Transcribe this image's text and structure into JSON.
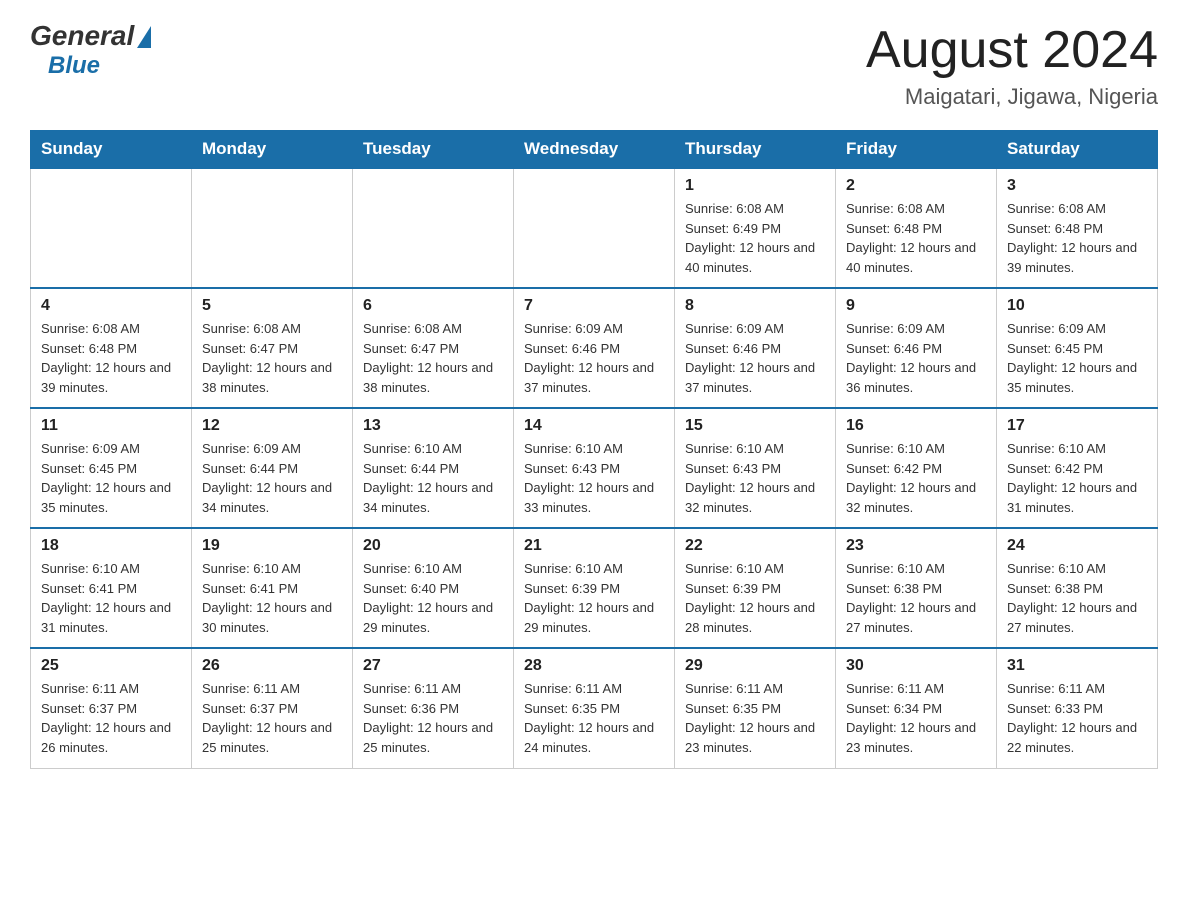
{
  "header": {
    "logo_general": "General",
    "logo_blue": "Blue",
    "month_title": "August 2024",
    "location": "Maigatari, Jigawa, Nigeria"
  },
  "days_of_week": [
    "Sunday",
    "Monday",
    "Tuesday",
    "Wednesday",
    "Thursday",
    "Friday",
    "Saturday"
  ],
  "weeks": [
    [
      {
        "day": "",
        "info": ""
      },
      {
        "day": "",
        "info": ""
      },
      {
        "day": "",
        "info": ""
      },
      {
        "day": "",
        "info": ""
      },
      {
        "day": "1",
        "info": "Sunrise: 6:08 AM\nSunset: 6:49 PM\nDaylight: 12 hours and 40 minutes."
      },
      {
        "day": "2",
        "info": "Sunrise: 6:08 AM\nSunset: 6:48 PM\nDaylight: 12 hours and 40 minutes."
      },
      {
        "day": "3",
        "info": "Sunrise: 6:08 AM\nSunset: 6:48 PM\nDaylight: 12 hours and 39 minutes."
      }
    ],
    [
      {
        "day": "4",
        "info": "Sunrise: 6:08 AM\nSunset: 6:48 PM\nDaylight: 12 hours and 39 minutes."
      },
      {
        "day": "5",
        "info": "Sunrise: 6:08 AM\nSunset: 6:47 PM\nDaylight: 12 hours and 38 minutes."
      },
      {
        "day": "6",
        "info": "Sunrise: 6:08 AM\nSunset: 6:47 PM\nDaylight: 12 hours and 38 minutes."
      },
      {
        "day": "7",
        "info": "Sunrise: 6:09 AM\nSunset: 6:46 PM\nDaylight: 12 hours and 37 minutes."
      },
      {
        "day": "8",
        "info": "Sunrise: 6:09 AM\nSunset: 6:46 PM\nDaylight: 12 hours and 37 minutes."
      },
      {
        "day": "9",
        "info": "Sunrise: 6:09 AM\nSunset: 6:46 PM\nDaylight: 12 hours and 36 minutes."
      },
      {
        "day": "10",
        "info": "Sunrise: 6:09 AM\nSunset: 6:45 PM\nDaylight: 12 hours and 35 minutes."
      }
    ],
    [
      {
        "day": "11",
        "info": "Sunrise: 6:09 AM\nSunset: 6:45 PM\nDaylight: 12 hours and 35 minutes."
      },
      {
        "day": "12",
        "info": "Sunrise: 6:09 AM\nSunset: 6:44 PM\nDaylight: 12 hours and 34 minutes."
      },
      {
        "day": "13",
        "info": "Sunrise: 6:10 AM\nSunset: 6:44 PM\nDaylight: 12 hours and 34 minutes."
      },
      {
        "day": "14",
        "info": "Sunrise: 6:10 AM\nSunset: 6:43 PM\nDaylight: 12 hours and 33 minutes."
      },
      {
        "day": "15",
        "info": "Sunrise: 6:10 AM\nSunset: 6:43 PM\nDaylight: 12 hours and 32 minutes."
      },
      {
        "day": "16",
        "info": "Sunrise: 6:10 AM\nSunset: 6:42 PM\nDaylight: 12 hours and 32 minutes."
      },
      {
        "day": "17",
        "info": "Sunrise: 6:10 AM\nSunset: 6:42 PM\nDaylight: 12 hours and 31 minutes."
      }
    ],
    [
      {
        "day": "18",
        "info": "Sunrise: 6:10 AM\nSunset: 6:41 PM\nDaylight: 12 hours and 31 minutes."
      },
      {
        "day": "19",
        "info": "Sunrise: 6:10 AM\nSunset: 6:41 PM\nDaylight: 12 hours and 30 minutes."
      },
      {
        "day": "20",
        "info": "Sunrise: 6:10 AM\nSunset: 6:40 PM\nDaylight: 12 hours and 29 minutes."
      },
      {
        "day": "21",
        "info": "Sunrise: 6:10 AM\nSunset: 6:39 PM\nDaylight: 12 hours and 29 minutes."
      },
      {
        "day": "22",
        "info": "Sunrise: 6:10 AM\nSunset: 6:39 PM\nDaylight: 12 hours and 28 minutes."
      },
      {
        "day": "23",
        "info": "Sunrise: 6:10 AM\nSunset: 6:38 PM\nDaylight: 12 hours and 27 minutes."
      },
      {
        "day": "24",
        "info": "Sunrise: 6:10 AM\nSunset: 6:38 PM\nDaylight: 12 hours and 27 minutes."
      }
    ],
    [
      {
        "day": "25",
        "info": "Sunrise: 6:11 AM\nSunset: 6:37 PM\nDaylight: 12 hours and 26 minutes."
      },
      {
        "day": "26",
        "info": "Sunrise: 6:11 AM\nSunset: 6:37 PM\nDaylight: 12 hours and 25 minutes."
      },
      {
        "day": "27",
        "info": "Sunrise: 6:11 AM\nSunset: 6:36 PM\nDaylight: 12 hours and 25 minutes."
      },
      {
        "day": "28",
        "info": "Sunrise: 6:11 AM\nSunset: 6:35 PM\nDaylight: 12 hours and 24 minutes."
      },
      {
        "day": "29",
        "info": "Sunrise: 6:11 AM\nSunset: 6:35 PM\nDaylight: 12 hours and 23 minutes."
      },
      {
        "day": "30",
        "info": "Sunrise: 6:11 AM\nSunset: 6:34 PM\nDaylight: 12 hours and 23 minutes."
      },
      {
        "day": "31",
        "info": "Sunrise: 6:11 AM\nSunset: 6:33 PM\nDaylight: 12 hours and 22 minutes."
      }
    ]
  ]
}
